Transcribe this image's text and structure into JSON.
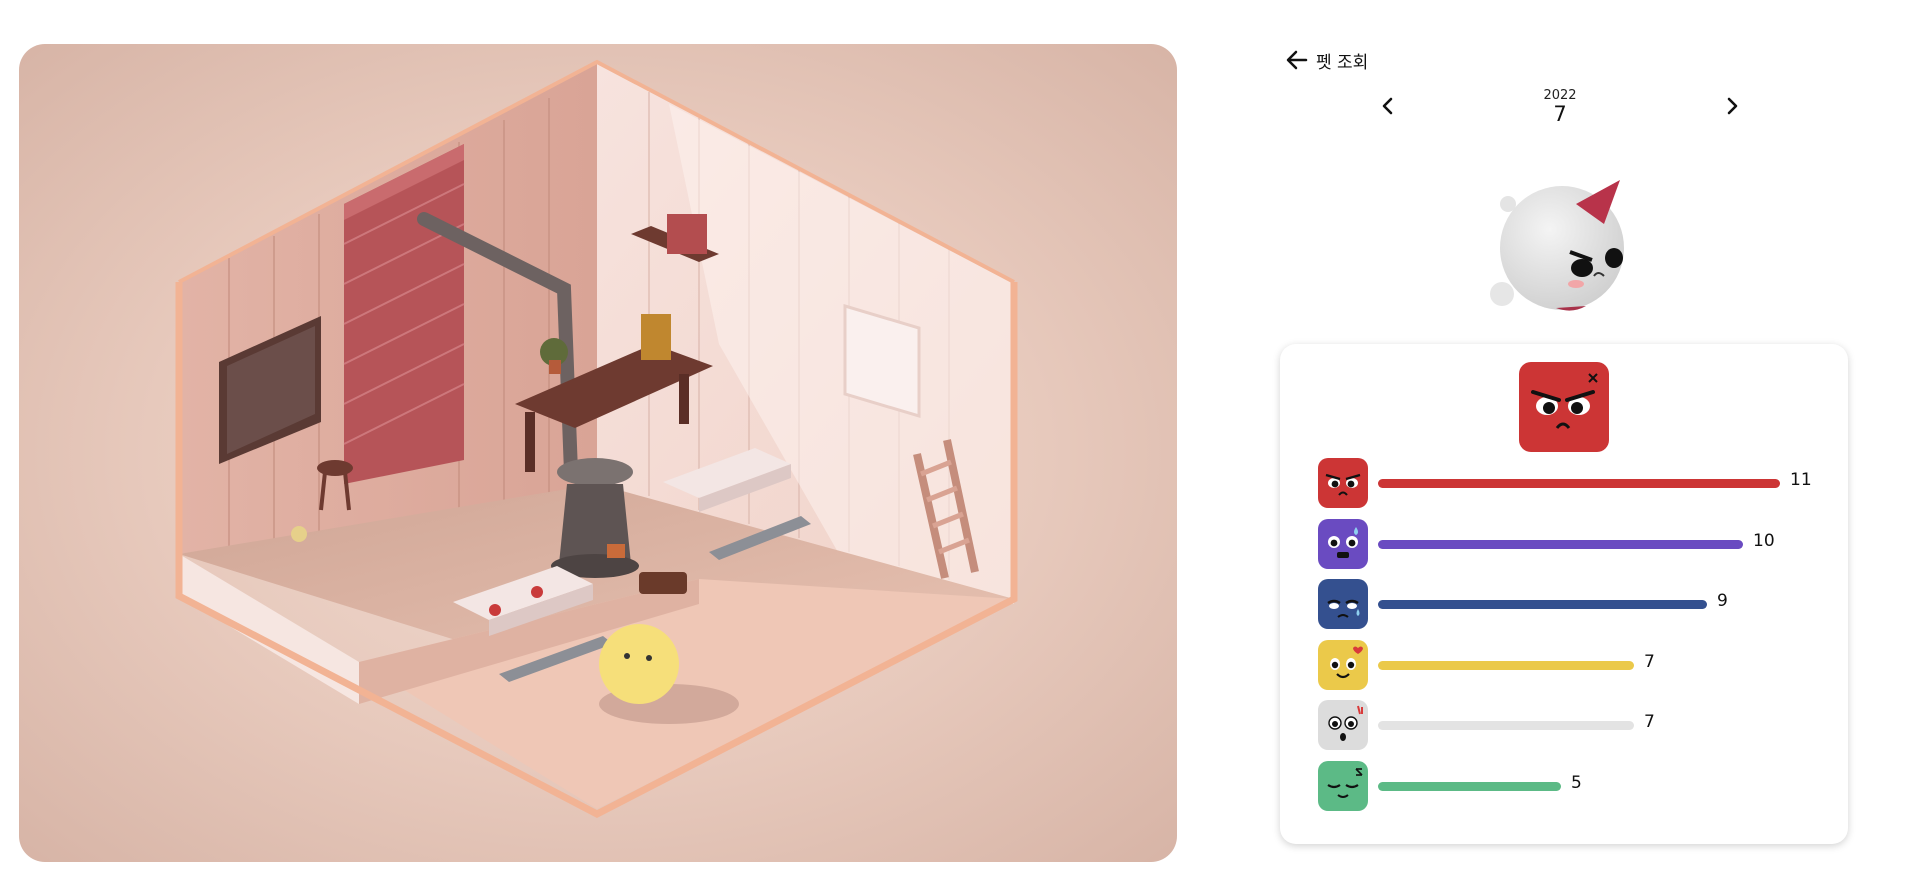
{
  "header": {
    "back_label": "펫 조회"
  },
  "date_nav": {
    "year": "2022",
    "month": "7"
  },
  "emotions": [
    {
      "name": "anger",
      "color": "#cc3535",
      "count": 11,
      "count_label": "11"
    },
    {
      "name": "fear",
      "color": "#6a4bc1",
      "count": 10,
      "count_label": "10"
    },
    {
      "name": "sadness",
      "color": "#34508f",
      "count": 9,
      "count_label": "9"
    },
    {
      "name": "joy",
      "color": "#ebc94a",
      "count": 7,
      "count_label": "7"
    },
    {
      "name": "surprise",
      "color": "#e3e3e3",
      "count": 7,
      "count_label": "7"
    },
    {
      "name": "calm",
      "color": "#5cba86",
      "count": 5,
      "count_label": "5"
    }
  ],
  "dominant_emotion": "anger",
  "icons": {
    "back": "arrow-left-icon",
    "prev": "chevron-left-icon",
    "next": "chevron-right-icon"
  }
}
